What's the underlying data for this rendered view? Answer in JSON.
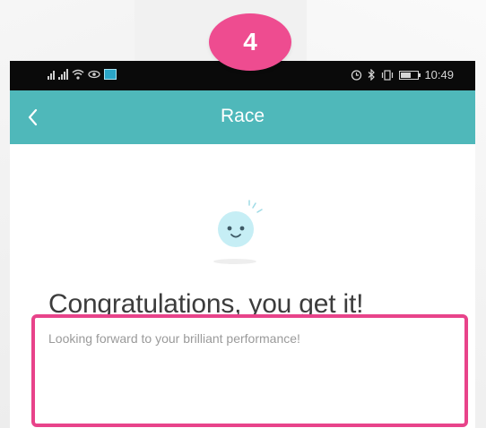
{
  "annotation": {
    "step_number": "4",
    "badge_color": "#ee4c90",
    "highlight_color": "#e8438a"
  },
  "status_bar": {
    "left_icons": [
      "sim-signal-icon",
      "signal-icon",
      "wifi-icon",
      "eye-icon",
      "image-icon"
    ],
    "right_icons": [
      "alarm-icon",
      "bluetooth-icon",
      "vibrate-icon",
      "battery-icon"
    ],
    "time": "10:49"
  },
  "header": {
    "title": "Race",
    "back_icon": "chevron-left-icon",
    "color": "#4fb8ba"
  },
  "content": {
    "mascot_icon": "smiley-mascot-icon",
    "title": "Congratulations, you get it!",
    "subtitle": "Looking forward to your brilliant performance!"
  }
}
